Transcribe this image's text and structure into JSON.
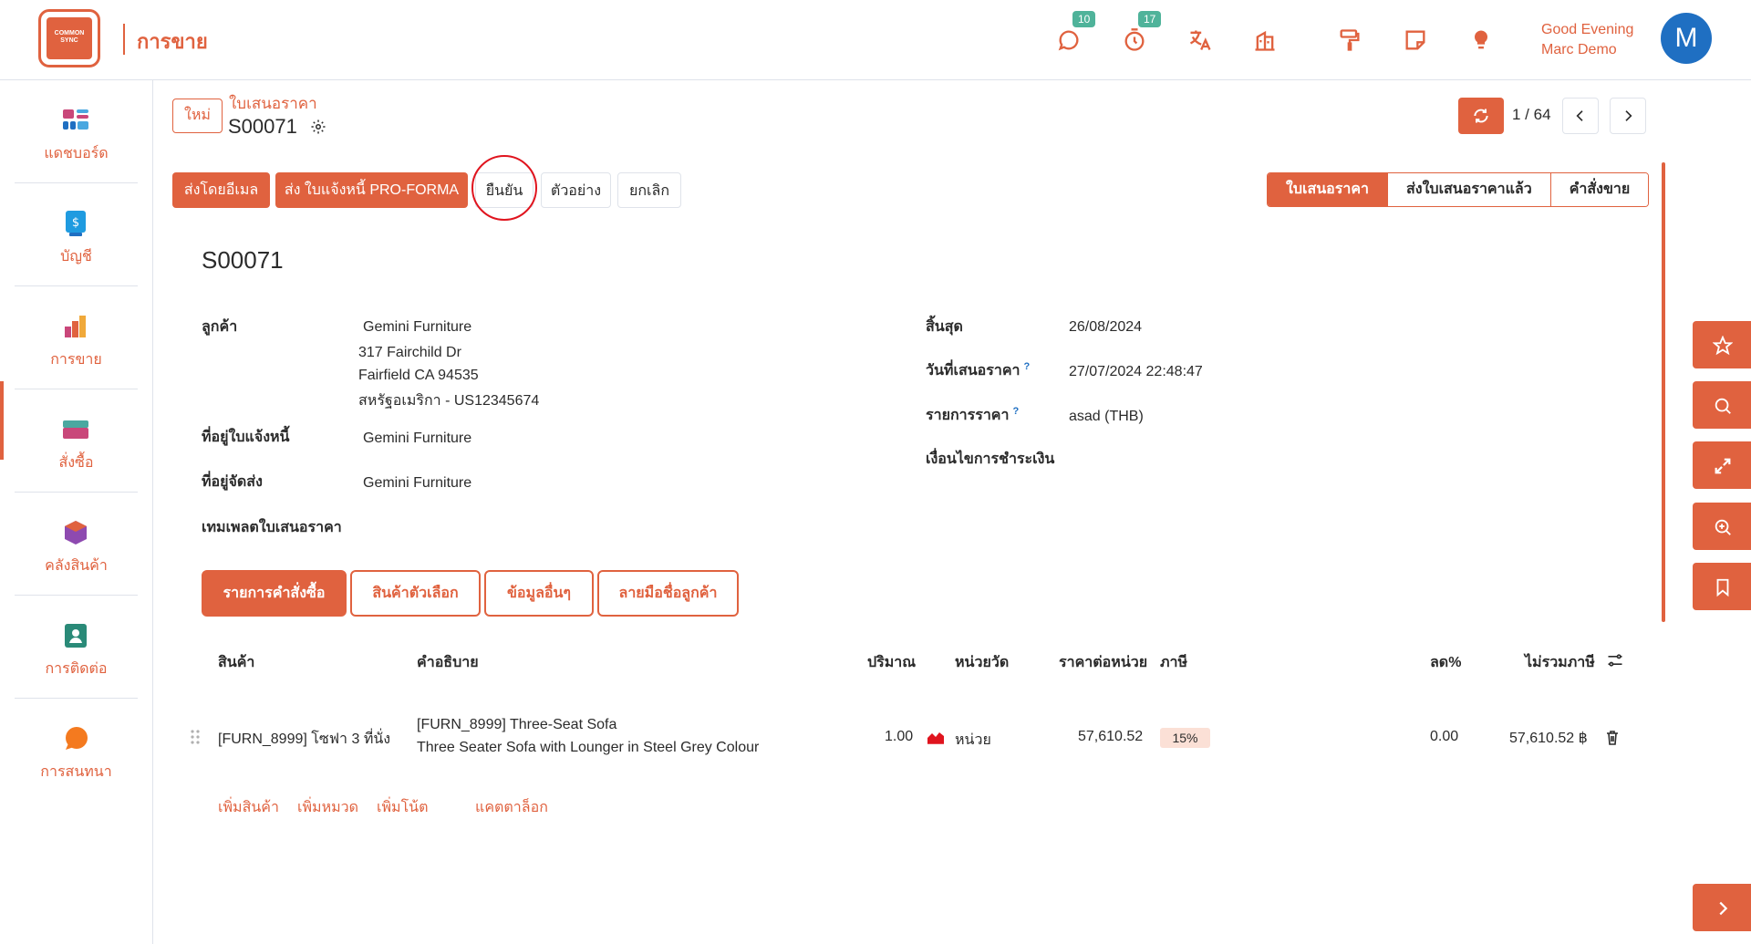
{
  "app": {
    "logo_text": "COMMON SYNC",
    "title": "การขาย"
  },
  "topbar": {
    "chat_badge": "10",
    "timer_badge": "17",
    "greeting_line1": "Good Evening",
    "greeting_line2": "Marc Demo",
    "avatar_letter": "M"
  },
  "sidebar": {
    "items": [
      {
        "label": "แดชบอร์ด",
        "icon": "dashboard-icon"
      },
      {
        "label": "บัญชี",
        "icon": "accounting-icon"
      },
      {
        "label": "การขาย",
        "icon": "sales-icon"
      },
      {
        "label": "สั่งซื้อ",
        "icon": "purchase-icon"
      },
      {
        "label": "คลังสินค้า",
        "icon": "inventory-icon"
      },
      {
        "label": "การติดต่อ",
        "icon": "contacts-icon"
      },
      {
        "label": "การสนทนา",
        "icon": "discuss-icon"
      }
    ]
  },
  "control": {
    "new_label": "ใหม่",
    "breadcrumb_parent": "ใบเสนอราคา",
    "breadcrumb_current": "S00071",
    "pager": "1 / 64"
  },
  "actions": {
    "send_email": "ส่งโดยอีเมล",
    "proforma": "ส่ง ใบแจ้งหนี้ PRO-FORMA",
    "confirm": "ยืนยัน",
    "preview": "ตัวอย่าง",
    "cancel": "ยกเลิก"
  },
  "status": {
    "stages": [
      "ใบเสนอราคา",
      "ส่งใบเสนอราคาแล้ว",
      "คำสั่งขาย"
    ],
    "active_index": 0
  },
  "form": {
    "title": "S00071",
    "customer_label": "ลูกค้า",
    "customer_name": "Gemini Furniture",
    "address_line1": "317 Fairchild Dr",
    "address_line2": "Fairfield CA 94535",
    "address_line3": "สหรัฐอเมริกา - US12345674",
    "invoice_address_label": "ที่อยู่ใบแจ้งหนี้",
    "invoice_address": "Gemini Furniture",
    "delivery_address_label": "ที่อยู่จัดส่ง",
    "delivery_address": "Gemini Furniture",
    "template_label": "เทมเพลตใบเสนอราคา",
    "expiration_label": "สิ้นสุด",
    "expiration": "26/08/2024",
    "quotation_date_label": "วันที่เสนอราคา",
    "quotation_date": "27/07/2024 22:48:47",
    "pricelist_label": "รายการราคา",
    "pricelist": "asad (THB)",
    "payment_terms_label": "เงื่อนไขการชำระเงิน"
  },
  "tabs": [
    "รายการคำสั่งซื้อ",
    "สินค้าตัวเลือก",
    "ข้อมูลอื่นๆ",
    "ลายมือชื่อลูกค้า"
  ],
  "table": {
    "headers": {
      "product": "สินค้า",
      "description": "คำอธิบาย",
      "quantity": "ปริมาณ",
      "uom": "หน่วยวัด",
      "unit_price": "ราคาต่อหน่วย",
      "taxes": "ภาษี",
      "discount": "ลด%",
      "subtotal": "ไม่รวมภาษี"
    },
    "rows": [
      {
        "product": "[FURN_8999] โซฟา 3 ที่นั่ง",
        "description_line1": "[FURN_8999] Three-Seat Sofa",
        "description_line2": "Three Seater Sofa with Lounger in Steel Grey Colour",
        "quantity": "1.00",
        "uom": "หน่วย",
        "unit_price": "57,610.52",
        "tax": "15%",
        "discount": "0.00",
        "subtotal": "57,610.52 ฿"
      }
    ],
    "add_links": {
      "add_product": "เพิ่มสินค้า",
      "add_section": "เพิ่มหมวด",
      "add_note": "เพิ่มโน้ต",
      "catalog": "แคตตาล็อก"
    }
  },
  "colors": {
    "accent": "#e0623f",
    "badge": "#4fb39a",
    "avatar": "#1f6fc2",
    "highlight_circle": "#e0141e"
  }
}
